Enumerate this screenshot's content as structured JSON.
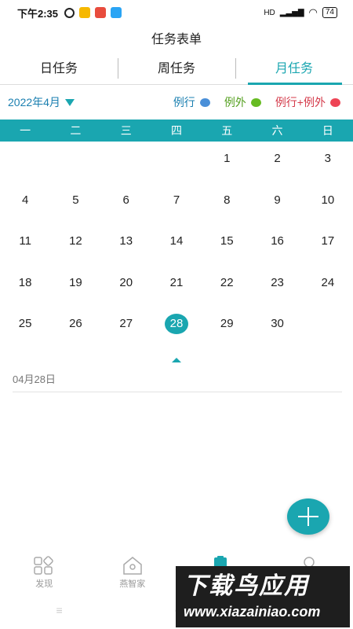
{
  "status_bar": {
    "time": "下午2:35",
    "network": "HD",
    "battery": "74"
  },
  "page_title": "任务表单",
  "tabs": [
    {
      "label": "日任务"
    },
    {
      "label": "周任务"
    },
    {
      "label": "月任务"
    }
  ],
  "month_selector": "2022年4月",
  "legend": [
    {
      "label": "例行",
      "color": "#4a8fd8"
    },
    {
      "label": "例外",
      "color": "#66bb22"
    },
    {
      "label": "例行+例外",
      "color": "#ee4455"
    }
  ],
  "weekdays": [
    "一",
    "二",
    "三",
    "四",
    "五",
    "六",
    "日"
  ],
  "calendar": {
    "weeks": [
      [
        "",
        "",
        "",
        "",
        "1",
        "2",
        "3"
      ],
      [
        "4",
        "5",
        "6",
        "7",
        "8",
        "9",
        "10"
      ],
      [
        "11",
        "12",
        "13",
        "14",
        "15",
        "16",
        "17"
      ],
      [
        "18",
        "19",
        "20",
        "21",
        "22",
        "23",
        "24"
      ],
      [
        "25",
        "26",
        "27",
        "28",
        "29",
        "30",
        ""
      ]
    ],
    "selected_day": "28"
  },
  "selected_date_label": "04月28日",
  "bottom_nav": [
    {
      "label": "发现",
      "icon": "discover-icon"
    },
    {
      "label": "燕智家",
      "icon": "home-icon"
    },
    {
      "label": "",
      "icon": "tasks-icon"
    },
    {
      "label": "",
      "icon": "profile-icon"
    }
  ],
  "watermark": {
    "title": "下载鸟应用",
    "url": "www.xiazainiao.com"
  },
  "colors": {
    "accent": "#1aa6b0"
  }
}
